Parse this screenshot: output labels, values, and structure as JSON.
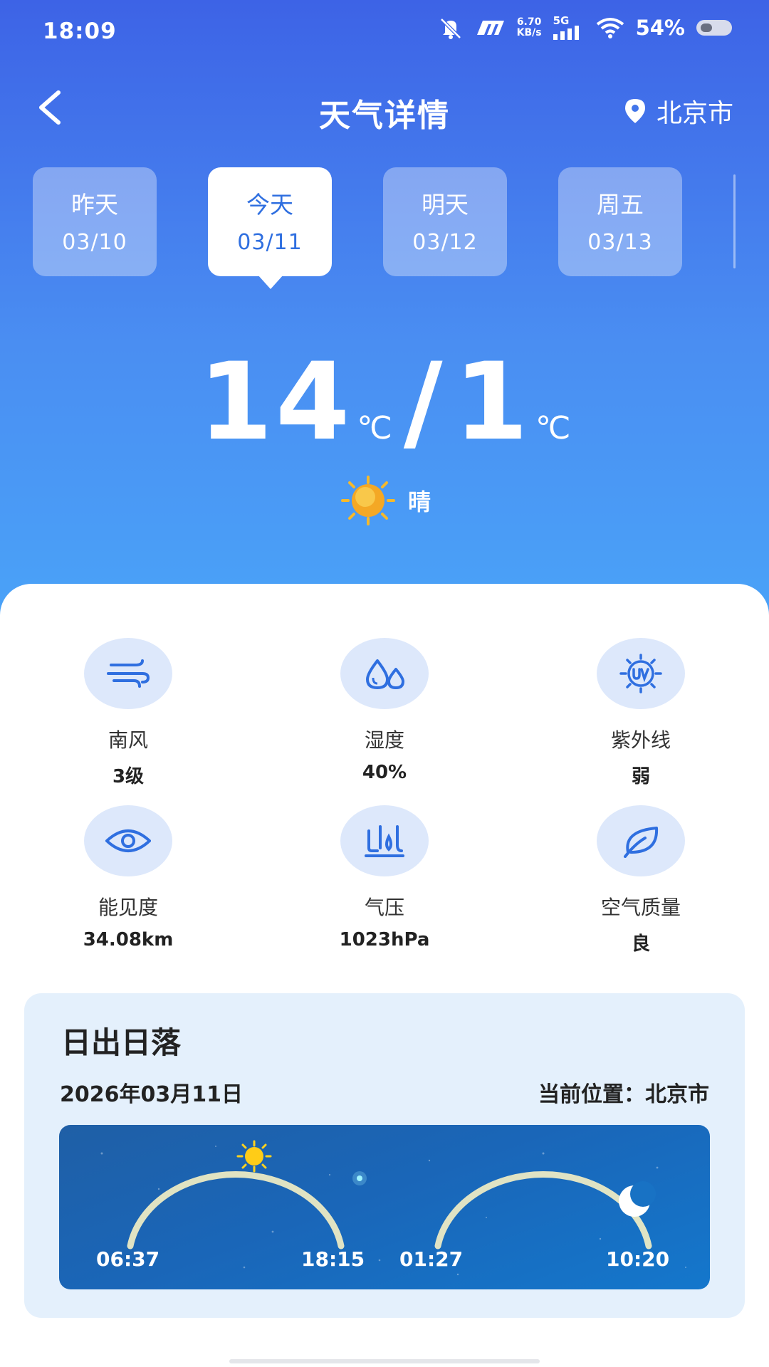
{
  "status_bar": {
    "time": "18:09",
    "net_speed_value": "6.70",
    "net_speed_unit": "KB/s",
    "network_type": "5G",
    "battery_percent": "54%"
  },
  "header": {
    "title": "天气详情",
    "location": "北京市"
  },
  "days": [
    {
      "name": "昨天",
      "date": "03/10",
      "active": false
    },
    {
      "name": "今天",
      "date": "03/11",
      "active": true
    },
    {
      "name": "明天",
      "date": "03/12",
      "active": false
    },
    {
      "name": "周五",
      "date": "03/13",
      "active": false
    }
  ],
  "temperature": {
    "high": "14",
    "low": "1",
    "unit": "℃",
    "separator": "/",
    "condition": "晴"
  },
  "stats": [
    {
      "icon": "wind-icon",
      "label": "南风",
      "value": "3级"
    },
    {
      "icon": "humidity-icon",
      "label": "湿度",
      "value": "40%"
    },
    {
      "icon": "uv-icon",
      "label": "紫外线",
      "value": "弱"
    },
    {
      "icon": "eye-icon",
      "label": "能见度",
      "value": "34.08km"
    },
    {
      "icon": "pressure-icon",
      "label": "气压",
      "value": "1023hPa"
    },
    {
      "icon": "leaf-icon",
      "label": "空气质量",
      "value": "良"
    }
  ],
  "sun_card": {
    "title": "日出日落",
    "date": "2026年03月11日",
    "location_label": "当前位置：",
    "location": "北京市",
    "sunrise": "06:37",
    "sunset": "18:15",
    "moonrise": "01:27",
    "moonset": "10:20"
  },
  "colors": {
    "accent": "#2f6fe0",
    "hero_top": "#3d63e6",
    "hero_bottom": "#4aa3f8",
    "icon_bg": "#dde8fb",
    "card_bg": "#e4f0fc"
  }
}
